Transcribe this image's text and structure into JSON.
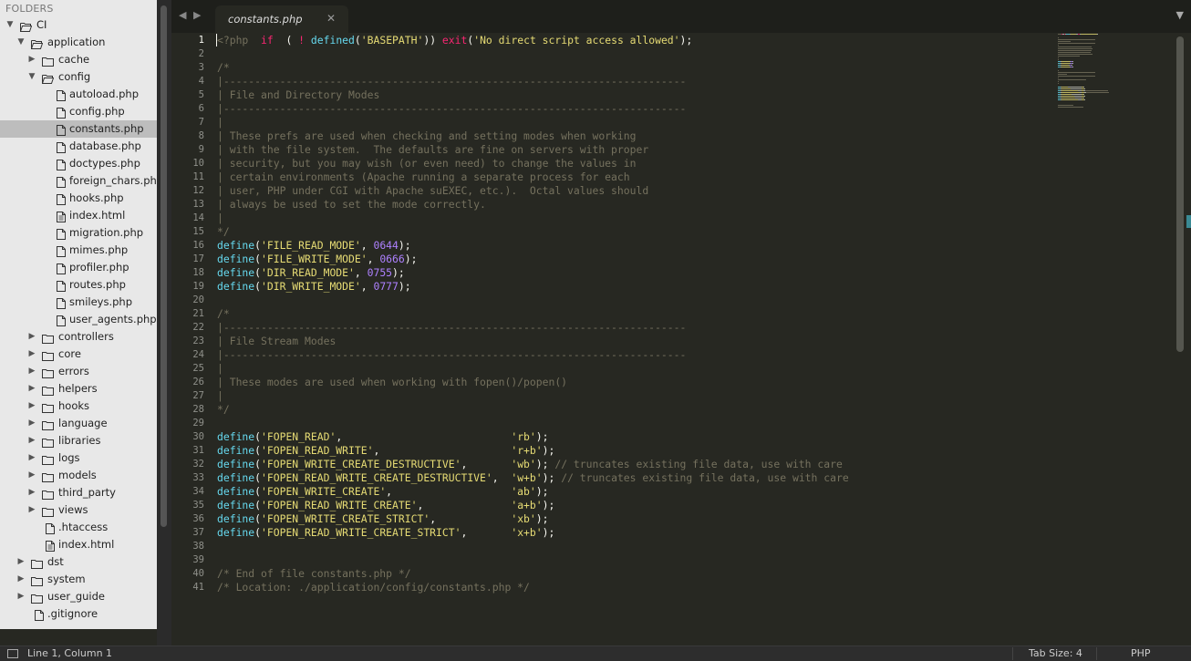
{
  "sidebar": {
    "header": "FOLDERS",
    "items": [
      {
        "label": "CI",
        "type": "folder",
        "open": true,
        "depth": 0
      },
      {
        "label": "application",
        "type": "folder",
        "open": true,
        "depth": 1
      },
      {
        "label": "cache",
        "type": "folder",
        "open": false,
        "depth": 2
      },
      {
        "label": "config",
        "type": "folder",
        "open": true,
        "depth": 2
      },
      {
        "label": "autoload.php",
        "type": "file",
        "depth": 3
      },
      {
        "label": "config.php",
        "type": "file",
        "depth": 3
      },
      {
        "label": "constants.php",
        "type": "file",
        "depth": 3,
        "selected": true
      },
      {
        "label": "database.php",
        "type": "file",
        "depth": 3
      },
      {
        "label": "doctypes.php",
        "type": "file",
        "depth": 3
      },
      {
        "label": "foreign_chars.php",
        "type": "file",
        "depth": 3
      },
      {
        "label": "hooks.php",
        "type": "file",
        "depth": 3
      },
      {
        "label": "index.html",
        "type": "html",
        "depth": 3
      },
      {
        "label": "migration.php",
        "type": "file",
        "depth": 3
      },
      {
        "label": "mimes.php",
        "type": "file",
        "depth": 3
      },
      {
        "label": "profiler.php",
        "type": "file",
        "depth": 3
      },
      {
        "label": "routes.php",
        "type": "file",
        "depth": 3
      },
      {
        "label": "smileys.php",
        "type": "file",
        "depth": 3
      },
      {
        "label": "user_agents.php",
        "type": "file",
        "depth": 3
      },
      {
        "label": "controllers",
        "type": "folder",
        "open": false,
        "depth": 2
      },
      {
        "label": "core",
        "type": "folder",
        "open": false,
        "depth": 2
      },
      {
        "label": "errors",
        "type": "folder",
        "open": false,
        "depth": 2
      },
      {
        "label": "helpers",
        "type": "folder",
        "open": false,
        "depth": 2
      },
      {
        "label": "hooks",
        "type": "folder",
        "open": false,
        "depth": 2
      },
      {
        "label": "language",
        "type": "folder",
        "open": false,
        "depth": 2
      },
      {
        "label": "libraries",
        "type": "folder",
        "open": false,
        "depth": 2
      },
      {
        "label": "logs",
        "type": "folder",
        "open": false,
        "depth": 2
      },
      {
        "label": "models",
        "type": "folder",
        "open": false,
        "depth": 2
      },
      {
        "label": "third_party",
        "type": "folder",
        "open": false,
        "depth": 2
      },
      {
        "label": "views",
        "type": "folder",
        "open": false,
        "depth": 2
      },
      {
        "label": ".htaccess",
        "type": "file",
        "depth": 2
      },
      {
        "label": "index.html",
        "type": "html",
        "depth": 2
      },
      {
        "label": "dst",
        "type": "folder",
        "open": false,
        "depth": 1
      },
      {
        "label": "system",
        "type": "folder",
        "open": false,
        "depth": 1
      },
      {
        "label": "user_guide",
        "type": "folder",
        "open": false,
        "depth": 1
      },
      {
        "label": ".gitignore",
        "type": "file",
        "depth": 1
      }
    ]
  },
  "tabbar": {
    "back_icon": "◀",
    "forward_icon": "▶",
    "active_tab": "constants.php",
    "close_icon": "✕",
    "menu_icon": "▼"
  },
  "editor": {
    "current_line": 1,
    "lines": [
      [
        [
          "cm",
          "<?php  "
        ],
        [
          "kw",
          "if"
        ],
        [
          "",
          "  ( "
        ],
        [
          "kw",
          "!"
        ],
        [
          "",
          " "
        ],
        [
          "fn",
          "defined"
        ],
        [
          "",
          "("
        ],
        [
          "st",
          "'BASEPATH'"
        ],
        [
          "",
          ")) "
        ],
        [
          "kw",
          "exit"
        ],
        [
          "",
          "("
        ],
        [
          "st",
          "'No direct script access allowed'"
        ],
        [
          "",
          ");"
        ]
      ],
      [],
      [
        [
          "cm",
          "/*"
        ]
      ],
      [
        [
          "cm",
          "|--------------------------------------------------------------------------"
        ]
      ],
      [
        [
          "cm",
          "| File and Directory Modes"
        ]
      ],
      [
        [
          "cm",
          "|--------------------------------------------------------------------------"
        ]
      ],
      [
        [
          "cm",
          "|"
        ]
      ],
      [
        [
          "cm",
          "| These prefs are used when checking and setting modes when working"
        ]
      ],
      [
        [
          "cm",
          "| with the file system.  The defaults are fine on servers with proper"
        ]
      ],
      [
        [
          "cm",
          "| security, but you may wish (or even need) to change the values in"
        ]
      ],
      [
        [
          "cm",
          "| certain environments (Apache running a separate process for each"
        ]
      ],
      [
        [
          "cm",
          "| user, PHP under CGI with Apache suEXEC, etc.).  Octal values should"
        ]
      ],
      [
        [
          "cm",
          "| always be used to set the mode correctly."
        ]
      ],
      [
        [
          "cm",
          "|"
        ]
      ],
      [
        [
          "cm",
          "*/"
        ]
      ],
      [
        [
          "fn",
          "define"
        ],
        [
          "",
          "("
        ],
        [
          "st",
          "'FILE_READ_MODE'"
        ],
        [
          "",
          ", "
        ],
        [
          "nu",
          "0644"
        ],
        [
          "",
          ");"
        ]
      ],
      [
        [
          "fn",
          "define"
        ],
        [
          "",
          "("
        ],
        [
          "st",
          "'FILE_WRITE_MODE'"
        ],
        [
          "",
          ", "
        ],
        [
          "nu",
          "0666"
        ],
        [
          "",
          ");"
        ]
      ],
      [
        [
          "fn",
          "define"
        ],
        [
          "",
          "("
        ],
        [
          "st",
          "'DIR_READ_MODE'"
        ],
        [
          "",
          ", "
        ],
        [
          "nu",
          "0755"
        ],
        [
          "",
          ");"
        ]
      ],
      [
        [
          "fn",
          "define"
        ],
        [
          "",
          "("
        ],
        [
          "st",
          "'DIR_WRITE_MODE'"
        ],
        [
          "",
          ", "
        ],
        [
          "nu",
          "0777"
        ],
        [
          "",
          ");"
        ]
      ],
      [],
      [
        [
          "cm",
          "/*"
        ]
      ],
      [
        [
          "cm",
          "|--------------------------------------------------------------------------"
        ]
      ],
      [
        [
          "cm",
          "| File Stream Modes"
        ]
      ],
      [
        [
          "cm",
          "|--------------------------------------------------------------------------"
        ]
      ],
      [
        [
          "cm",
          "|"
        ]
      ],
      [
        [
          "cm",
          "| These modes are used when working with fopen()/popen()"
        ]
      ],
      [
        [
          "cm",
          "|"
        ]
      ],
      [
        [
          "cm",
          "*/"
        ]
      ],
      [],
      [
        [
          "fn",
          "define"
        ],
        [
          "",
          "("
        ],
        [
          "st",
          "'FOPEN_READ'"
        ],
        [
          ",",
          "                           "
        ],
        [
          "st",
          "'rb'"
        ],
        [
          "",
          ");"
        ]
      ],
      [
        [
          "fn",
          "define"
        ],
        [
          "",
          "("
        ],
        [
          "st",
          "'FOPEN_READ_WRITE'"
        ],
        [
          ",",
          "                     "
        ],
        [
          "st",
          "'r+b'"
        ],
        [
          "",
          ");"
        ]
      ],
      [
        [
          "fn",
          "define"
        ],
        [
          "",
          "("
        ],
        [
          "st",
          "'FOPEN_WRITE_CREATE_DESTRUCTIVE'"
        ],
        [
          ",",
          "       "
        ],
        [
          "st",
          "'wb'"
        ],
        [
          "",
          "); "
        ],
        [
          "cm",
          "// truncates existing file data, use with care"
        ]
      ],
      [
        [
          "fn",
          "define"
        ],
        [
          "",
          "("
        ],
        [
          "st",
          "'FOPEN_READ_WRITE_CREATE_DESTRUCTIVE'"
        ],
        [
          ",",
          "  "
        ],
        [
          "st",
          "'w+b'"
        ],
        [
          "",
          "); "
        ],
        [
          "cm",
          "// truncates existing file data, use with care"
        ]
      ],
      [
        [
          "fn",
          "define"
        ],
        [
          "",
          "("
        ],
        [
          "st",
          "'FOPEN_WRITE_CREATE'"
        ],
        [
          ",",
          "                   "
        ],
        [
          "st",
          "'ab'"
        ],
        [
          "",
          ");"
        ]
      ],
      [
        [
          "fn",
          "define"
        ],
        [
          "",
          "("
        ],
        [
          "st",
          "'FOPEN_READ_WRITE_CREATE'"
        ],
        [
          ",",
          "              "
        ],
        [
          "st",
          "'a+b'"
        ],
        [
          "",
          ");"
        ]
      ],
      [
        [
          "fn",
          "define"
        ],
        [
          "",
          "("
        ],
        [
          "st",
          "'FOPEN_WRITE_CREATE_STRICT'"
        ],
        [
          ",",
          "            "
        ],
        [
          "st",
          "'xb'"
        ],
        [
          "",
          ");"
        ]
      ],
      [
        [
          "fn",
          "define"
        ],
        [
          "",
          "("
        ],
        [
          "st",
          "'FOPEN_READ_WRITE_CREATE_STRICT'"
        ],
        [
          ",",
          "       "
        ],
        [
          "st",
          "'x+b'"
        ],
        [
          "",
          ");"
        ]
      ],
      [],
      [],
      [
        [
          "cm",
          "/* End of file constants.php */"
        ]
      ],
      [
        [
          "cm",
          "/* Location: ./application/config/constants.php */"
        ]
      ]
    ]
  },
  "statusbar": {
    "position": "Line 1, Column 1",
    "tab_size": "Tab Size: 4",
    "syntax": "PHP"
  },
  "colors": {
    "editor_bg": "#272822",
    "keyword": "#f92672",
    "function": "#66d9ef",
    "string": "#e6db74",
    "number": "#ae81ff",
    "comment": "#75715e"
  }
}
